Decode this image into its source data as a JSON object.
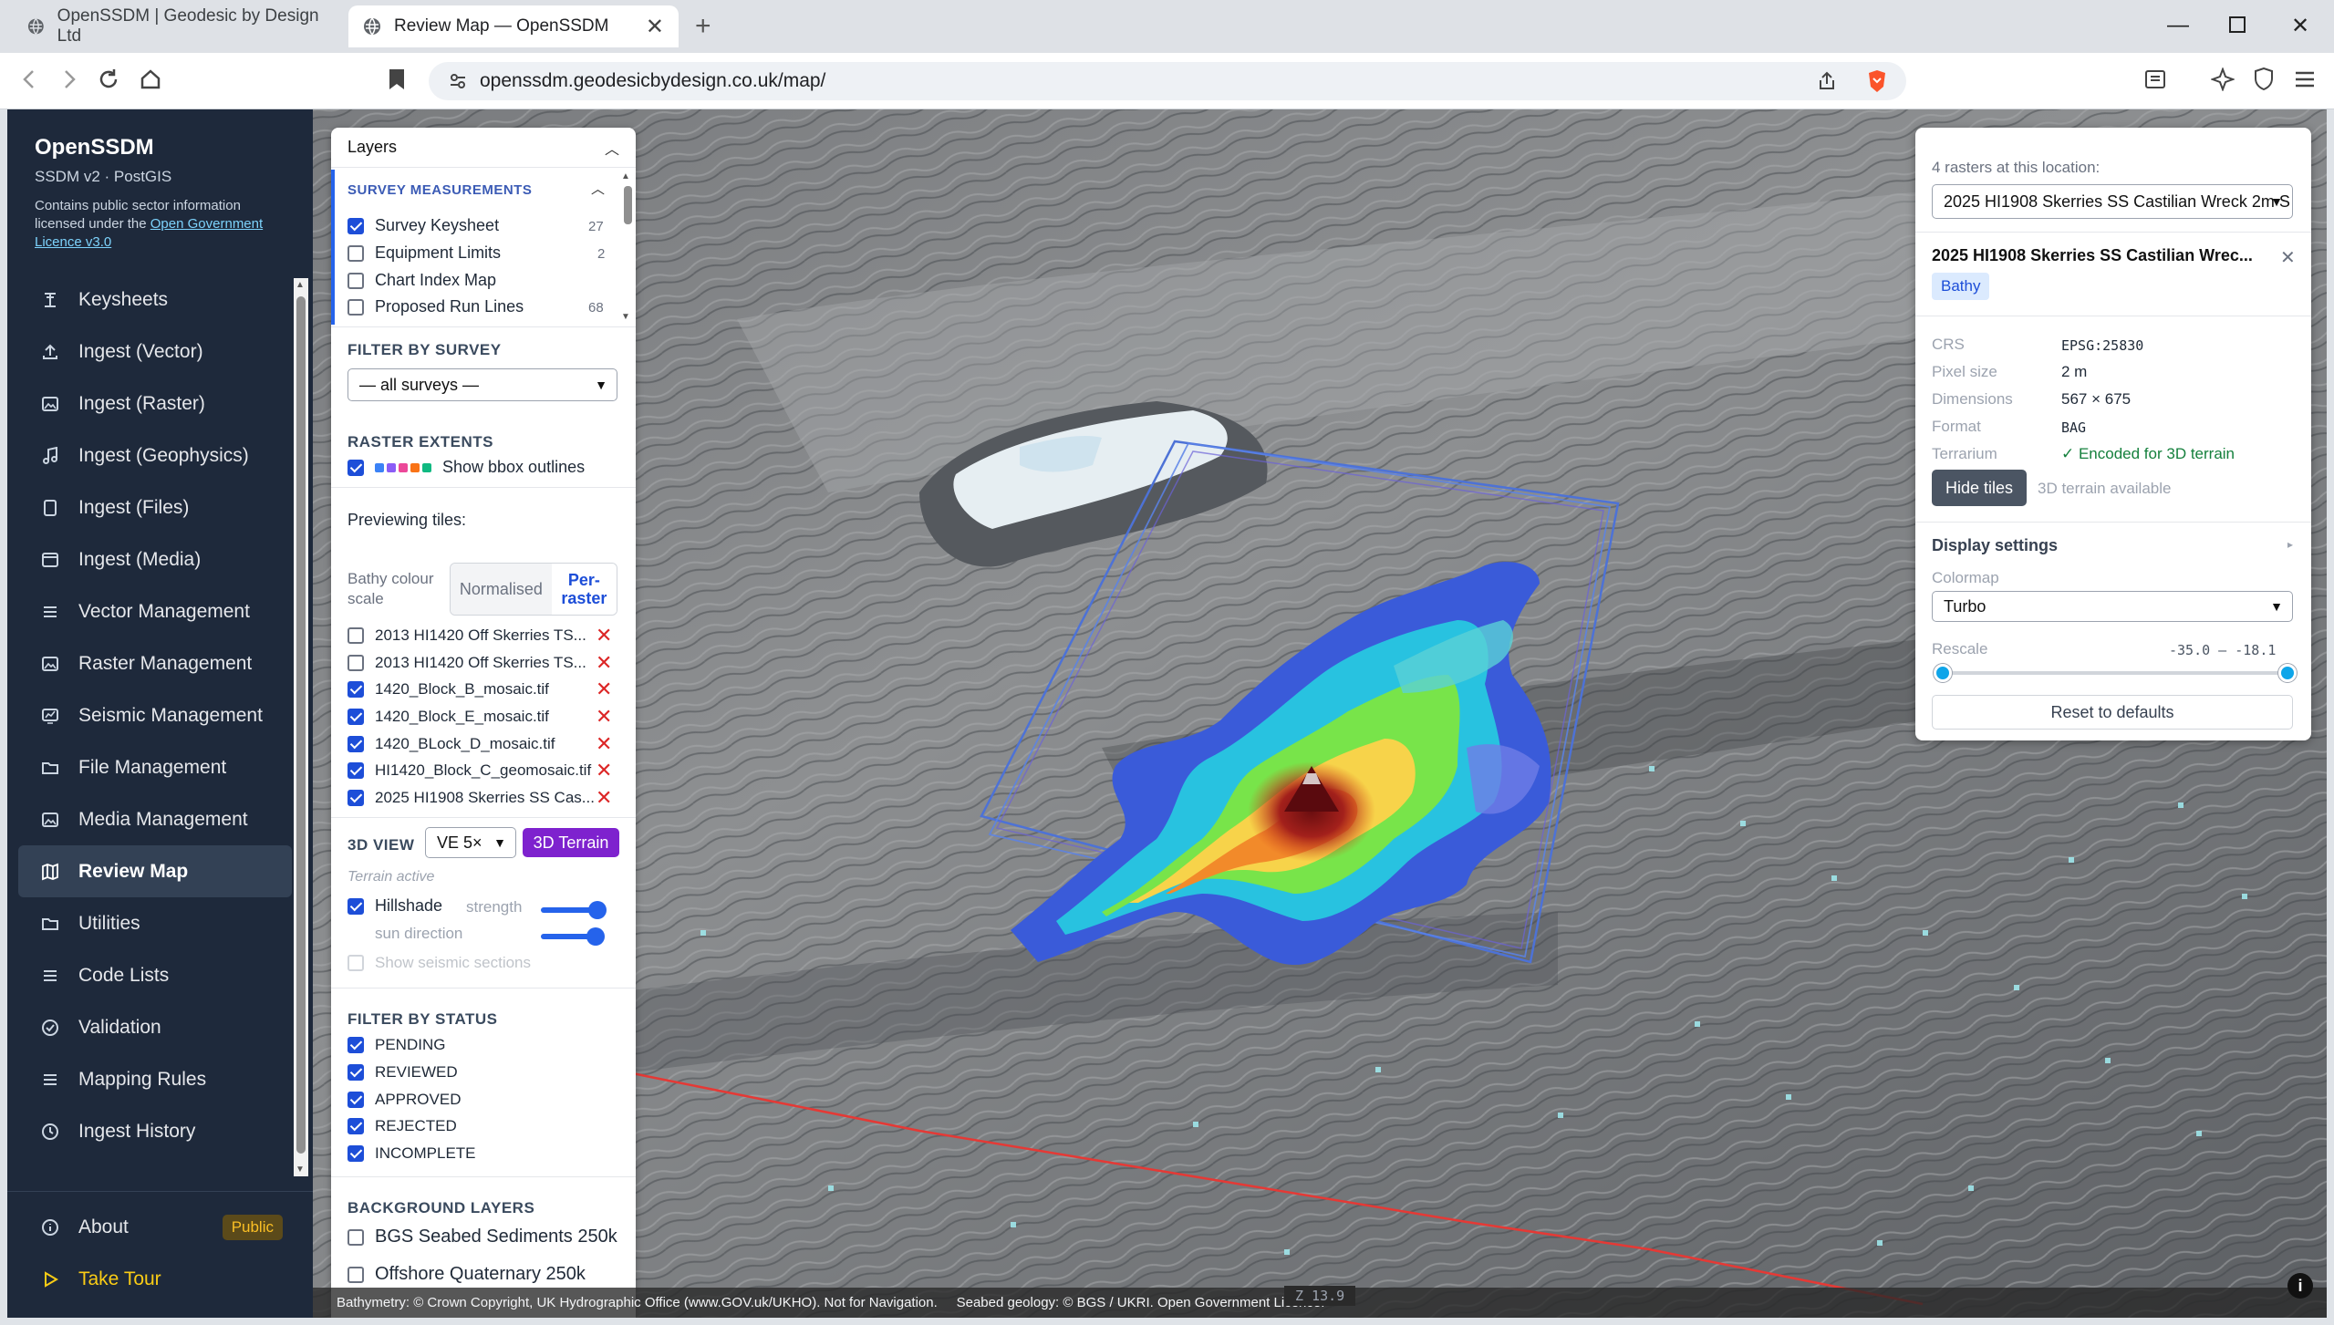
{
  "browser": {
    "tabs": [
      {
        "title": "OpenSSDM | Geodesic by Design Ltd"
      },
      {
        "title": "Review Map — OpenSSDM"
      }
    ],
    "url": "openssdm.geodesicbydesign.co.uk/map/"
  },
  "sidebar": {
    "title": "OpenSSDM",
    "subtitle": "SSDM v2 · PostGIS",
    "licence_prefix": "Contains public sector information licensed under the ",
    "licence_link": "Open Government Licence v3.0",
    "items": [
      {
        "label": "Keysheets",
        "icon": "keysheet-icon"
      },
      {
        "label": "Ingest (Vector)",
        "icon": "upload-icon"
      },
      {
        "label": "Ingest (Raster)",
        "icon": "image-icon"
      },
      {
        "label": "Ingest (Geophysics)",
        "icon": "music-note-icon"
      },
      {
        "label": "Ingest (Files)",
        "icon": "file-icon"
      },
      {
        "label": "Ingest (Media)",
        "icon": "media-icon"
      },
      {
        "label": "Vector Management",
        "icon": "list-icon"
      },
      {
        "label": "Raster Management",
        "icon": "image-icon"
      },
      {
        "label": "Seismic Management",
        "icon": "chart-icon"
      },
      {
        "label": "File Management",
        "icon": "folder-icon"
      },
      {
        "label": "Media Management",
        "icon": "image-icon"
      },
      {
        "label": "Review Map",
        "icon": "map-icon"
      },
      {
        "label": "Utilities",
        "icon": "folder-icon"
      },
      {
        "label": "Code Lists",
        "icon": "list-icon"
      },
      {
        "label": "Validation",
        "icon": "check-circle-icon"
      },
      {
        "label": "Mapping Rules",
        "icon": "list-icon"
      },
      {
        "label": "Ingest History",
        "icon": "clock-icon"
      }
    ],
    "active": "Review Map",
    "about": "About",
    "about_badge": "Public",
    "tour": "Take Tour"
  },
  "layers": {
    "title": "Layers",
    "survey_section": "SURVEY MEASUREMENTS",
    "survey_items": [
      {
        "label": "Survey Keysheet",
        "count": "27",
        "checked": true
      },
      {
        "label": "Equipment Limits",
        "count": "2",
        "checked": false
      },
      {
        "label": "Chart Index Map",
        "count": "",
        "checked": false
      },
      {
        "label": "Proposed Run Lines",
        "count": "68",
        "checked": false
      }
    ],
    "filter_survey_title": "FILTER BY SURVEY",
    "filter_survey_value": "— all surveys —",
    "raster_extents_title": "RASTER EXTENTS",
    "show_bbox_label": "Show bbox outlines",
    "bbox_colors": [
      "#3b82f6",
      "#8b5cf6",
      "#ec4899",
      "#f97316",
      "#10b981"
    ],
    "previewing_label": "Previewing tiles:",
    "bathy_scale_label": "Bathy colour scale",
    "scale_options": [
      "Normalised",
      "Per-raster"
    ],
    "tiles": [
      {
        "label": "2013 HI1420 Off Skerries TS...",
        "checked": false
      },
      {
        "label": "2013 HI1420 Off Skerries TS...",
        "checked": false
      },
      {
        "label": "1420_Block_B_mosaic.tif",
        "checked": true
      },
      {
        "label": "1420_Block_E_mosaic.tif",
        "checked": true
      },
      {
        "label": "1420_BLock_D_mosaic.tif",
        "checked": true
      },
      {
        "label": "HI1420_Block_C_geomosaic.tif",
        "checked": true
      },
      {
        "label": "2025 HI1908 Skerries SS Cas...",
        "checked": true
      }
    ],
    "view3d_label": "3D VIEW",
    "ve_value": "VE 5×",
    "terrain_button": "3D Terrain",
    "terrain_active": "Terrain active",
    "hillshade_label": "Hillshade",
    "strength_label": "strength",
    "sun_label": "sun direction",
    "hillshade_strength": 0.85,
    "sun_direction": 0.82,
    "seismic_label": "Show seismic sections",
    "filter_status_title": "FILTER BY STATUS",
    "statuses": [
      "PENDING",
      "REVIEWED",
      "APPROVED",
      "REJECTED",
      "INCOMPLETE"
    ],
    "background_title": "BACKGROUND LAYERS",
    "backgrounds": [
      "BGS Seabed Sediments 250k",
      "Offshore Quaternary 250k"
    ]
  },
  "raster_panel": {
    "count_text": "4 rasters at this location:",
    "selected_raster": "2025 HI1908 Skerries SS Castilian Wreck 2m S",
    "raster_title": "2025 HI1908 Skerries SS Castilian Wrec...",
    "tag": "Bathy",
    "props": [
      {
        "label": "CRS",
        "value": "EPSG:25830"
      },
      {
        "label": "Pixel size",
        "value": "2 m"
      },
      {
        "label": "Dimensions",
        "value": "567 × 675"
      },
      {
        "label": "Format",
        "value": "BAG"
      },
      {
        "label": "Terrarium",
        "value": "✓ Encoded for 3D terrain"
      }
    ],
    "hide_tiles": "Hide tiles",
    "terrain_available": "3D terrain available",
    "display_settings": "Display settings",
    "colormap_label": "Colormap",
    "colormap_value": "Turbo",
    "rescale_label": "Rescale",
    "rescale_value": "-35.0 – -18.1",
    "reset_label": "Reset to defaults"
  },
  "map": {
    "attribution": "Bathymetry: © Crown Copyright, UK Hydrographic Office (www.GOV.uk/UKHO). Not for Navigation.     Seabed geology: © BGS / UKRI. Open Government Licence.",
    "zoom_text": "Z 13.9"
  },
  "colors": {
    "sidebar_bg": "#1e293b",
    "accent": "#2563eb",
    "terrain_button": "#7e22ce",
    "danger": "#dc2626",
    "success": "#15803d"
  }
}
